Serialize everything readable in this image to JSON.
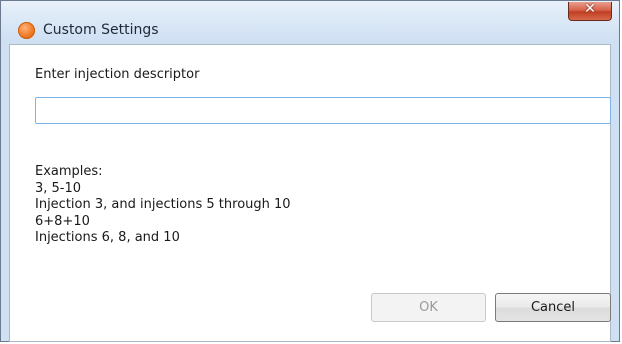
{
  "window": {
    "title": "Custom Settings",
    "close_glyph": "✕"
  },
  "form": {
    "prompt_label": "Enter injection descriptor",
    "descriptor_value": "",
    "descriptor_placeholder": ""
  },
  "examples": {
    "heading": "Examples:",
    "lines": [
      "3, 5-10",
      "Injection 3, and injections 5 through 10",
      "6+8+10",
      "Injections 6, 8, and 10"
    ]
  },
  "buttons": {
    "ok_label": "OK",
    "ok_enabled": false,
    "cancel_label": "Cancel"
  },
  "icons": {
    "app": "app-logo-icon",
    "close": "close-icon"
  },
  "colors": {
    "close_button": "#c13f24",
    "app_icon": "#f07a24",
    "input_border": "#7eb4ea"
  }
}
